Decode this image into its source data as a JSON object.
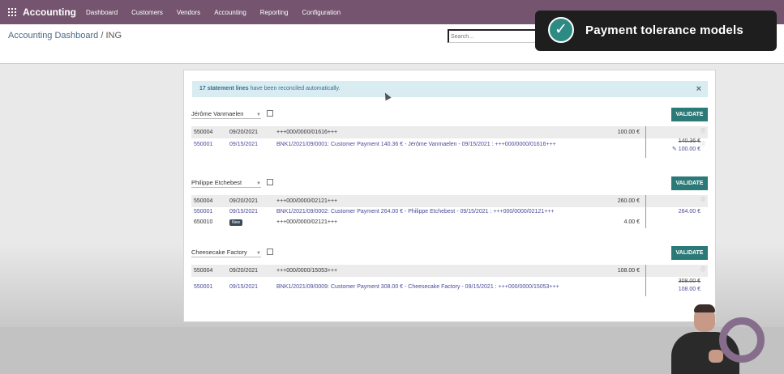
{
  "navbar": {
    "app_name": "Accounting",
    "menu": [
      "Dashboard",
      "Customers",
      "Vendors",
      "Accounting",
      "Reporting",
      "Configuration"
    ]
  },
  "breadcrumb": {
    "parent": "Accounting Dashboard",
    "separator": "/",
    "current": "ING"
  },
  "search": {
    "placeholder": "Search..."
  },
  "alert": {
    "count": "17 statement lines",
    "text": " have been reconciled automatically."
  },
  "validate_label": "VALIDATE",
  "groups": [
    {
      "partner": "Jérôme Vanmaelen",
      "rows": [
        {
          "account": "550004",
          "date": "09/20/2021",
          "label": "+++000/0000/01616+++",
          "amount": "100.00 €",
          "right": ""
        },
        {
          "account": "550001",
          "date": "09/15/2021",
          "label": "BNK1/2021/09/0001: Customer Payment 140.36 € - Jérôme Vanmaelen - 09/15/2021 : +++000/0000/01616+++",
          "amount": "",
          "right_old": "140.36 €",
          "right": "100.00 €"
        }
      ]
    },
    {
      "partner": "Philippe Etchebest",
      "rows": [
        {
          "account": "550004",
          "date": "09/20/2021",
          "label": "+++000/0000/02121+++",
          "amount": "260.00 €",
          "right": ""
        },
        {
          "account": "550001",
          "date": "09/15/2021",
          "label": "BNK1/2021/09/0002: Customer Payment 264.00 € - Philippe Etchebest - 09/15/2021 : +++000/0000/02121+++",
          "amount": "",
          "right": "264.00 €"
        },
        {
          "account": "650010",
          "badge": "New",
          "label": "+++000/0000/02121+++",
          "amount": "4.00 €",
          "right": ""
        }
      ]
    },
    {
      "partner": "Cheesecake Factory",
      "rows": [
        {
          "account": "550004",
          "date": "09/20/2021",
          "label": "+++000/0000/15053+++",
          "amount": "108.00 €",
          "right": ""
        },
        {
          "account": "550001",
          "date": "09/15/2021",
          "label": "BNK1/2021/09/0009: Customer Payment 308.00 € - Cheesecake Factory - 09/15/2021 : +++000/0000/15053+++",
          "amount": "",
          "right_old": "308.00 €",
          "right": "108.00 €"
        }
      ]
    }
  ],
  "toast": {
    "title": "Payment tolerance models"
  },
  "colors": {
    "navbar": "#74546f",
    "validate": "#2b7a78",
    "alert_bg": "#d9ecf2",
    "toast_check": "#2e8b84"
  }
}
